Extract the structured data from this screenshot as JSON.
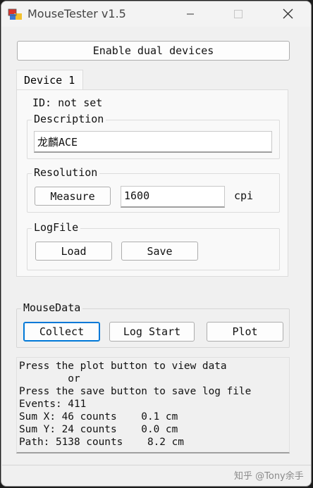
{
  "window": {
    "title": "MouseTester v1.5"
  },
  "top": {
    "enable_dual_label": "Enable dual devices"
  },
  "device_tab": {
    "label": "Device 1",
    "id_text": "ID: not set",
    "description": {
      "title": "Description",
      "value": "龙麟ACE"
    },
    "resolution": {
      "title": "Resolution",
      "measure_label": "Measure",
      "value": "1600",
      "unit": "cpi"
    },
    "logfile": {
      "title": "LogFile",
      "load_label": "Load",
      "save_label": "Save"
    }
  },
  "mouse_data": {
    "title": "MouseData",
    "collect_label": "Collect",
    "log_start_label": "Log Start",
    "plot_label": "Plot"
  },
  "output": {
    "lines": [
      "Press the plot button to view data",
      "        or",
      "Press the save button to save log file",
      "Events: 411",
      "Sum X: 46 counts    0.1 cm",
      "Sum Y: 24 counts    0.0 cm",
      "Path: 5138 counts    8.2 cm"
    ]
  },
  "watermark": "知乎 @Tony余手"
}
